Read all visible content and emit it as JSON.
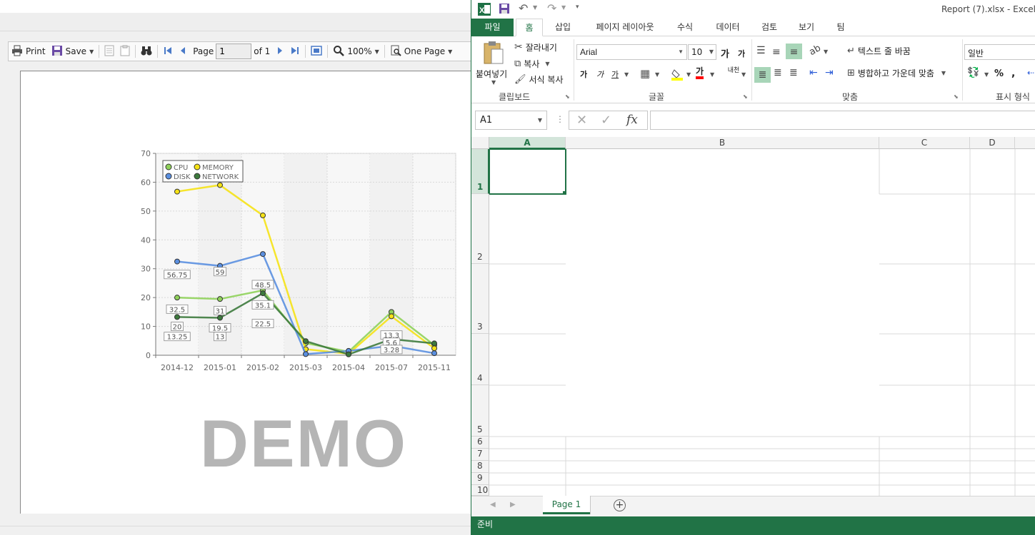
{
  "viewer": {
    "toolbar": {
      "print_label": "Print",
      "save_label": "Save",
      "page_label": "Page",
      "page_value": "1",
      "of_label": "of 1",
      "zoom": "100%",
      "view_mode": "One Page"
    },
    "watermark": "DEMO"
  },
  "chart_data": {
    "type": "line",
    "categories": [
      "2014-12",
      "2015-01",
      "2015-02",
      "2015-03",
      "2015-04",
      "2015-07",
      "2015-11"
    ],
    "ylim": [
      0,
      70
    ],
    "yticks": [
      0,
      10,
      20,
      30,
      40,
      50,
      60,
      70
    ],
    "grid": true,
    "legend_position": "top-left",
    "series": [
      {
        "name": "CPU",
        "color": "#8fd15a",
        "values": [
          20,
          19.5,
          22.5,
          4.2,
          1.2,
          15,
          3.5
        ]
      },
      {
        "name": "MEMORY",
        "color": "#f5e216",
        "values": [
          56.75,
          59,
          48.5,
          2.1,
          0.5,
          13.5,
          2.4
        ]
      },
      {
        "name": "DISK",
        "color": "#5a8fe0",
        "values": [
          32.5,
          31,
          35.1,
          0.4,
          1.5,
          3.3,
          0.7
        ]
      },
      {
        "name": "NETWORK",
        "color": "#3d7a3d",
        "values": [
          13.25,
          13,
          21.5,
          4.9,
          0.3,
          5.6,
          4.1
        ]
      }
    ],
    "data_labels": [
      {
        "text": "56.75",
        "x": "2014-12",
        "y": 28
      },
      {
        "text": "59",
        "x": "2015-01",
        "y": 29
      },
      {
        "text": "32.5",
        "x": "2014-12",
        "y": 16
      },
      {
        "text": "31",
        "x": "2015-01",
        "y": 15.5
      },
      {
        "text": "48.5",
        "x": "2015-02",
        "y": 24.5
      },
      {
        "text": "35.1",
        "x": "2015-02",
        "y": 17.5
      },
      {
        "text": "20",
        "x": "2014-12",
        "y": 10
      },
      {
        "text": "19.5",
        "x": "2015-01",
        "y": 9.5
      },
      {
        "text": "22.5",
        "x": "2015-02",
        "y": 11
      },
      {
        "text": "13.25",
        "x": "2014-12",
        "y": 6.5
      },
      {
        "text": "13",
        "x": "2015-01",
        "y": 6.5
      },
      {
        "text": "13.3",
        "x": "2015-07",
        "y": 7
      },
      {
        "text": "5.6",
        "x": "2015-07",
        "y": 4.5
      },
      {
        "text": "3.28",
        "x": "2015-07",
        "y": 2
      }
    ]
  },
  "excel": {
    "title": "Report (7).xlsx - Excel",
    "tabs": [
      "파일",
      "홈",
      "삽입",
      "페이지 레이아웃",
      "수식",
      "데이터",
      "검토",
      "보기",
      "팀"
    ],
    "active_tab": "홈",
    "clipboard": {
      "paste": "붙여넣기",
      "cut": "잘라내기",
      "copy": "복사",
      "format_painter": "서식 복사",
      "label": "클립보드"
    },
    "font": {
      "name": "Arial",
      "size": "10",
      "grow": "가",
      "shrink": "가",
      "bold": "가",
      "italic": "가",
      "underline": "가",
      "color_glyph": "가",
      "phonetic": "내천",
      "label": "글꼴",
      "fill_color": "#ffff00",
      "font_color": "#ff0000"
    },
    "alignment": {
      "wrap_text": "텍스트 줄 바꿈",
      "merge_center": "병합하고 가운데 맞춤",
      "label": "맞춤"
    },
    "number": {
      "format": "일반",
      "percent": "%",
      "comma": ",",
      "label": "표시 형식"
    },
    "name_box": "A1",
    "fx": "fx",
    "columns": [
      "A",
      "B",
      "C",
      "D"
    ],
    "rows": [
      "1",
      "2",
      "3",
      "4",
      "5",
      "6",
      "7",
      "8",
      "9",
      "10"
    ],
    "sheet_tab": "Page 1",
    "status": "준비"
  }
}
